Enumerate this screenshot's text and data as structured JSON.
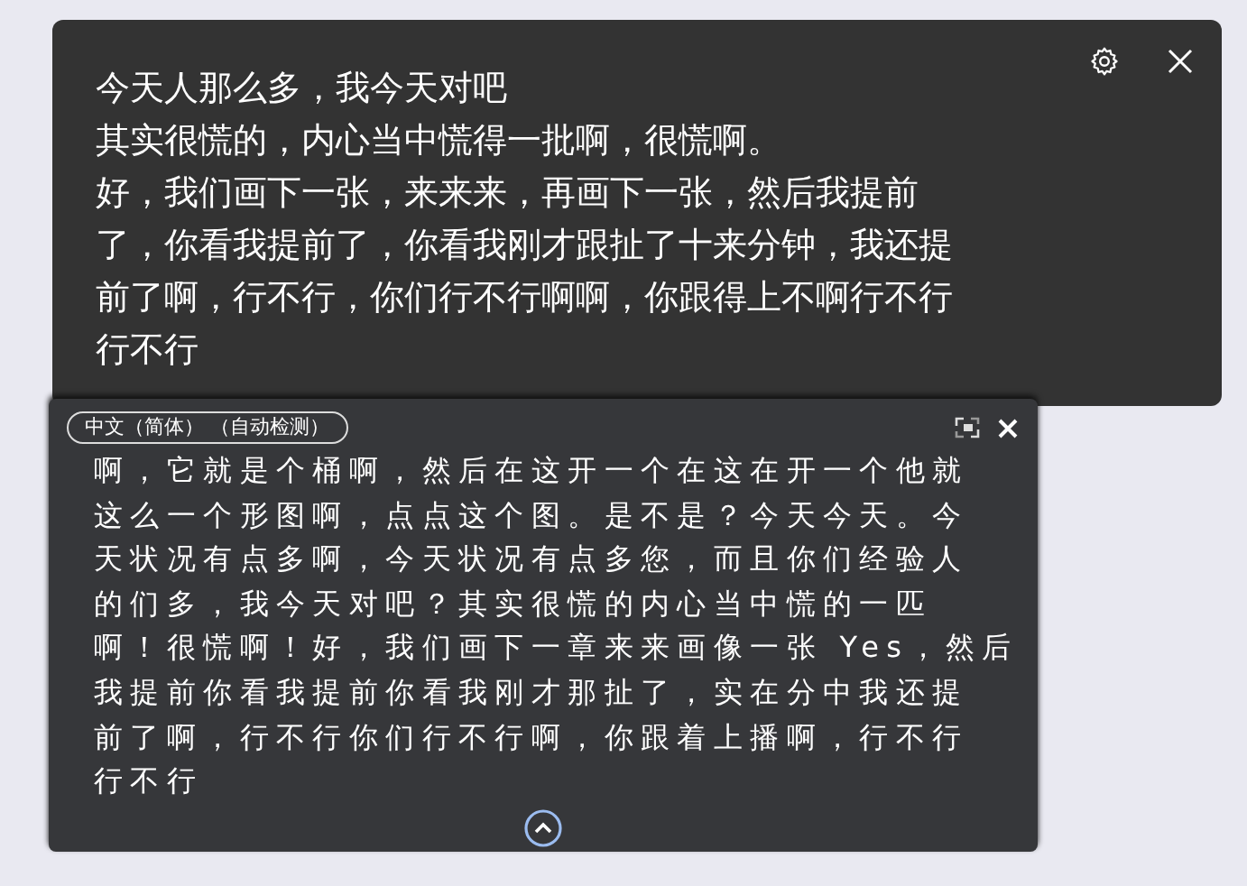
{
  "caption_window": {
    "lines": [
      "今天人那么多，我今天对吧",
      "其实很慌的，内心当中慌得一批啊，很慌啊。",
      "好，我们画下一张，来来来，再画下一张，然后我提前",
      "了，你看我提前了，你看我刚才跟扯了十来分钟，我还提",
      "前了啊，行不行，你们行不行啊啊，你跟得上不啊行不行",
      "行不行"
    ]
  },
  "transcript_panel": {
    "language": "中文（简体）  （自动检测）",
    "lines": [
      "啊，它就是个桶啊，然后在这开一个在这在开一个他就",
      "这么一个形图啊，点点这个图。是不是？今天今天。今",
      "天状况有点多啊，今天状况有点多您，而且你们经验人",
      "的们多，我今天对吧？其实很慌的内心当中慌的一匹",
      "啊！很慌啊！好，我们画下一章来来画像一张 Yes，然后",
      "我提前你看我提前你看我刚才那扯了，实在分中我还提",
      "前了啊，行不行你们行不行啊，你跟着上播啊，行不行",
      "行不行"
    ]
  }
}
